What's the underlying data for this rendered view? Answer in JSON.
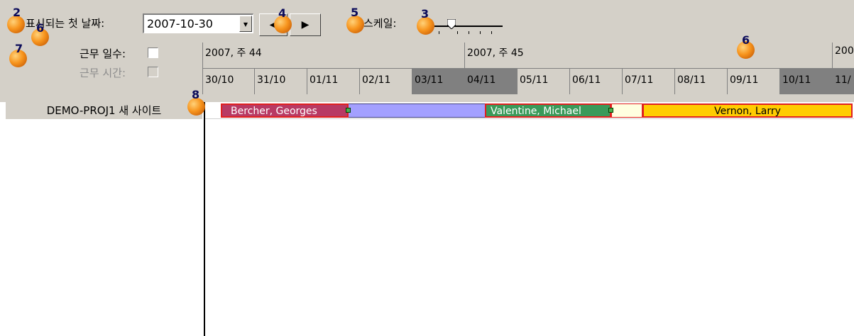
{
  "toolbar": {
    "first_day_label": "표시되는 첫 날짜:",
    "date_value": "2007-10-30",
    "scale_label": "스케일:",
    "prev_arrow": "◀",
    "next_arrow": "▶",
    "dropdown_arrow": "▼"
  },
  "options": {
    "working_days_label": "근무 일수:",
    "working_hours_label": "근무 시간:"
  },
  "timeline": {
    "weeks": [
      "2007, 주 44",
      "2007, 주 45",
      "200"
    ],
    "days": [
      "30/10",
      "31/10",
      "01/11",
      "02/11",
      "03/11",
      "04/11",
      "05/11",
      "06/11",
      "07/11",
      "08/11",
      "09/11",
      "10/11",
      "11/"
    ]
  },
  "project": {
    "name": "DEMO-PROJ1 새 사이트"
  },
  "bars": [
    {
      "label": "Bercher, Georges",
      "color": "#b83a64"
    },
    {
      "label": "",
      "color": "#a3a0ff"
    },
    {
      "label": "Valentine, Michael",
      "color": "#3a9a5a"
    },
    {
      "label": "",
      "color": "#ffffe0"
    },
    {
      "label": "Vernon, Larry",
      "color": "#ffcc00"
    }
  ],
  "markers": [
    "2",
    "6",
    "7",
    "4",
    "5",
    "3",
    "6",
    "8"
  ]
}
